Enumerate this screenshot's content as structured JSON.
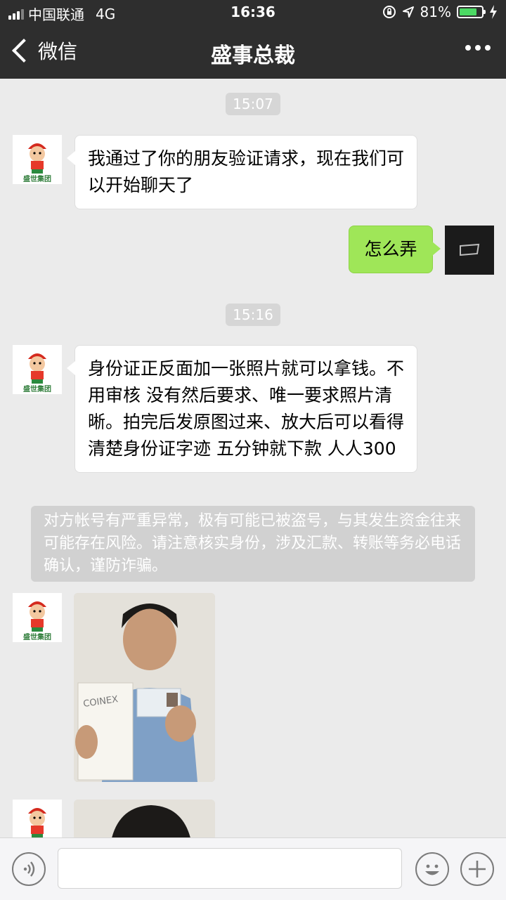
{
  "status_bar": {
    "carrier": "中国联通",
    "network": "4G",
    "time": "16:36",
    "battery": "81%",
    "battery_level": 0.81
  },
  "navbar": {
    "back_label": "微信",
    "title": "盛事总裁"
  },
  "chat": {
    "timestamps": [
      "15:07",
      "15:16"
    ],
    "messages": [
      {
        "side": "left",
        "text": "我通过了你的朋友验证请求，现在我们可以开始聊天了"
      },
      {
        "side": "right",
        "text": "怎么弄"
      },
      {
        "side": "left",
        "text": "身份证正反面加一张照片就可以拿钱。不用审核 没有然后要求、唯一要求照片清晰。拍完后发原图过来、放大后可以看得清楚身份证字迹 五分钟就下款 人人300"
      }
    ],
    "warning": "对方帐号有严重异常，极有可能已被盗号，与其发生资金往来可能存在风险。请注意核实身份，涉及汇款、转账等务必电话确认，谨防诈骗。",
    "avatar_caption": "盛世集团",
    "photo_paper_text": "COINEX"
  },
  "colors": {
    "header_bg": "#2e2e2e",
    "chat_bg": "#ebebeb",
    "bubble_right": "#9fe658",
    "battery_fill": "#4cd964"
  },
  "icons": [
    "voice-icon",
    "emoji-icon",
    "plus-icon",
    "back-chevron-icon",
    "more-icon",
    "location-arrow-icon",
    "lock-rotation-icon",
    "charging-icon"
  ]
}
